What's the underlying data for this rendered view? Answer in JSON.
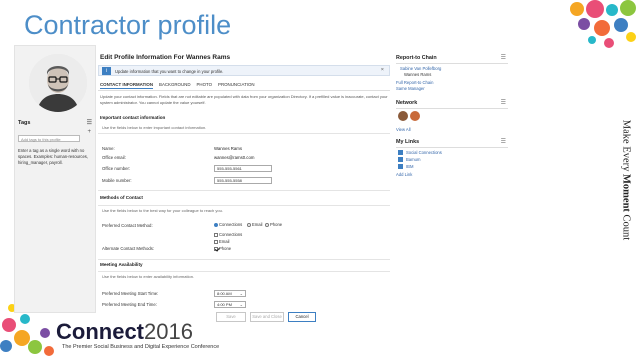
{
  "slide": {
    "title": "Contractor profile",
    "tagline_pre": "Make Every ",
    "tagline_bold": "Moment",
    "tagline_post": " Count",
    "logo_main": "Connect",
    "logo_year": "2016",
    "logo_tagline": "The Premier Social Business and Digital Experience Conference"
  },
  "tags": {
    "heading": "Tags",
    "input_placeholder": "Add tags to this profile",
    "add_symbol": "+",
    "help": "Enter a tag as a single word with no spaces. Examples: human-resources, hiring_manager, payroll."
  },
  "form": {
    "title": "Edit Profile Information For Wannes Rams",
    "info_message": "Update information that you want to change in your profile.",
    "info_close": "×",
    "tabs": [
      "CONTACT INFORMATION",
      "BACKGROUND",
      "PHOTO",
      "PRONUNCIATION"
    ],
    "intro": "Update your contact information. Fields that are not editable are populated with data from your organization Directory. If a prefilled value is inaccurate, contact your system administrator. You cannot update the value yourself.",
    "important": {
      "heading": "Important contact information",
      "sub": "Use the fields below to enter important contact information.",
      "name_label": "Name:",
      "name_value": "Wannes Rams",
      "email_label": "Office email:",
      "email_value": "wannes@rams0.com",
      "office_label": "Office number:",
      "office_value": "555-555-5561",
      "mobile_label": "Mobile number:",
      "mobile_value": "555-555-5558"
    },
    "methods": {
      "heading": "Methods of Contact",
      "sub": "Use the fields below to the best way for your colleague to reach you.",
      "preferred_label": "Preferred Contact Method:",
      "preferred_options": [
        "Connections",
        "Email",
        "Phone"
      ],
      "preferred_selected": "Connections",
      "alternate_label": "Alternate Contact Methods:",
      "alternate_options": [
        "Connections",
        "Email",
        "Phone"
      ],
      "alternate_checked": [
        "Phone"
      ]
    },
    "meeting": {
      "heading": "Meeting Availability",
      "sub": "Use the fields below to enter availability information.",
      "start_label": "Preferred Meeting Start Time:",
      "start_value": "8:00 AM",
      "end_label": "Preferred Meeting End Time:",
      "end_value": "4:00 PM"
    },
    "buttons": {
      "save": "Save",
      "save_close": "Save and Close",
      "cancel": "Cancel"
    }
  },
  "sidebar": {
    "report_heading": "Report-to Chain",
    "report_chain": [
      "Sabine Van Pollefborg",
      "Wannes Rams"
    ],
    "full_report": "Full Report-to Chain",
    "same_manager": "Same Manager",
    "network_heading": "Network",
    "view_all": "View All",
    "links_heading": "My Links",
    "links": [
      "Social Connections",
      "Bamum",
      "IBM"
    ],
    "add_link": "Add Link",
    "menu_symbol": "☰"
  },
  "colors": {
    "title_blue": "#4d8ec8",
    "accent": "#3d7fc2",
    "link": "#3366aa"
  }
}
